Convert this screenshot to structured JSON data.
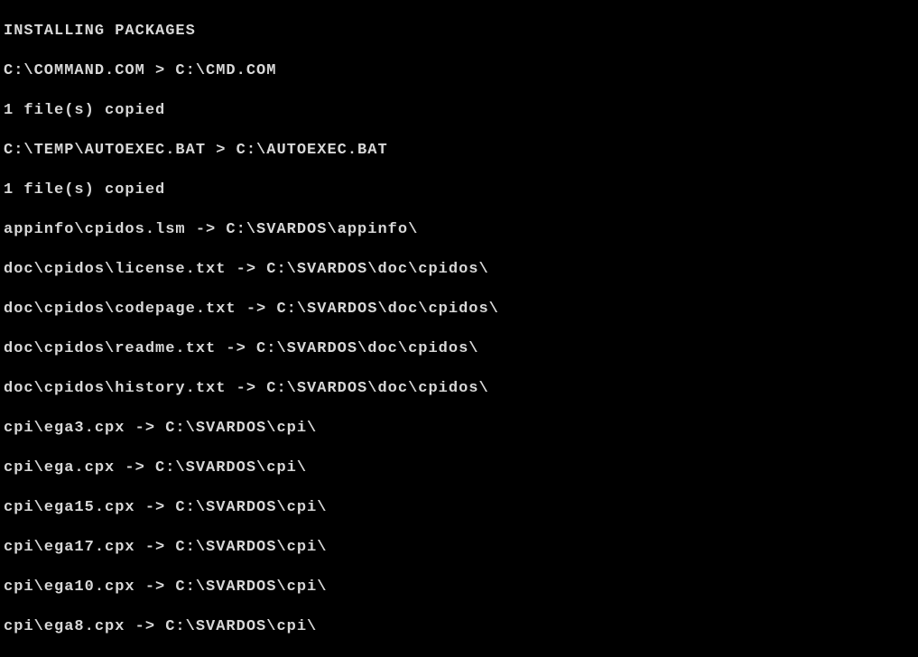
{
  "terminal": {
    "lines": [
      "INSTALLING PACKAGES",
      "C:\\COMMAND.COM > C:\\CMD.COM",
      "1 file(s) copied",
      "C:\\TEMP\\AUTOEXEC.BAT > C:\\AUTOEXEC.BAT",
      "1 file(s) copied",
      "appinfo\\cpidos.lsm -> C:\\SVARDOS\\appinfo\\",
      "doc\\cpidos\\license.txt -> C:\\SVARDOS\\doc\\cpidos\\",
      "doc\\cpidos\\codepage.txt -> C:\\SVARDOS\\doc\\cpidos\\",
      "doc\\cpidos\\readme.txt -> C:\\SVARDOS\\doc\\cpidos\\",
      "doc\\cpidos\\history.txt -> C:\\SVARDOS\\doc\\cpidos\\",
      "cpi\\ega3.cpx -> C:\\SVARDOS\\cpi\\",
      "cpi\\ega.cpx -> C:\\SVARDOS\\cpi\\",
      "cpi\\ega15.cpx -> C:\\SVARDOS\\cpi\\",
      "cpi\\ega17.cpx -> C:\\SVARDOS\\cpi\\",
      "cpi\\ega10.cpx -> C:\\SVARDOS\\cpi\\",
      "cpi\\ega8.cpx -> C:\\SVARDOS\\cpi\\"
    ]
  }
}
